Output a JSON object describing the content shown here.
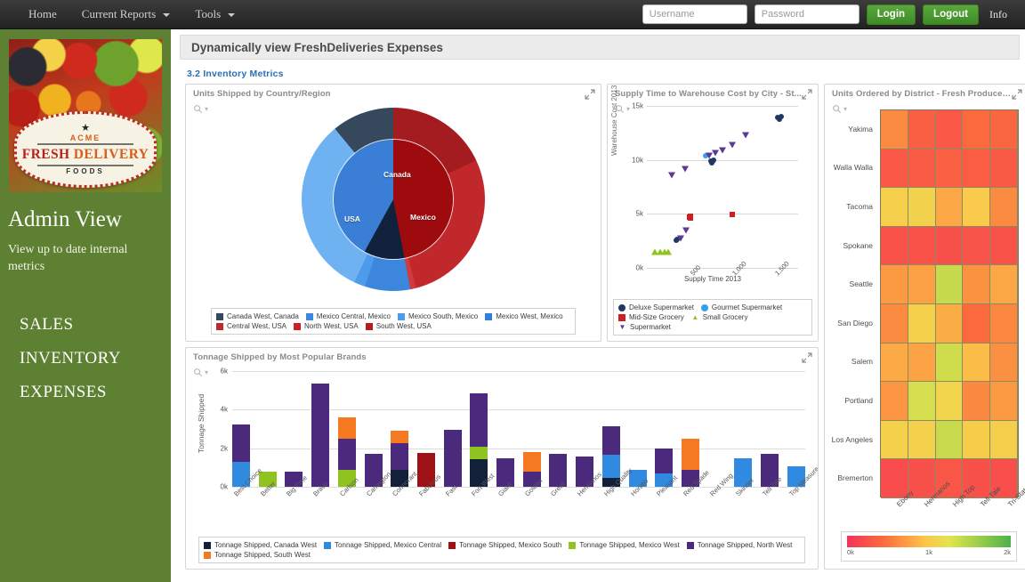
{
  "navbar": {
    "items": [
      {
        "label": "Home",
        "caret": false
      },
      {
        "label": "Current Reports",
        "caret": true
      },
      {
        "label": "Tools",
        "caret": true
      }
    ],
    "username_placeholder": "Username",
    "password_placeholder": "Password",
    "username_value": "",
    "password_value": "",
    "login_label": "Login",
    "logout_label": "Logout",
    "info_label": "Info",
    "accent_green": "#4a962d"
  },
  "sidebar": {
    "logo": {
      "star": "★",
      "acme": "ACME",
      "word1": "FRESH",
      "word2": "DELIVERY",
      "foods": "FOODS"
    },
    "title": "Admin View",
    "subtitle": "View up to date internal metrics",
    "links": [
      {
        "label": "SALES"
      },
      {
        "label": "INVENTORY"
      },
      {
        "label": "EXPENSES"
      }
    ],
    "bg_color": "#5d8032"
  },
  "header": {
    "title": "Dynamically view FreshDeliveries Expenses"
  },
  "section": {
    "title": "3.2 Inventory Metrics",
    "color": "#2a6fb5"
  },
  "panels": {
    "donut": {
      "title": "Units Shipped by Country/Region",
      "expand_icon": "expand-icon"
    },
    "scatter": {
      "title": "Supply Time to Warehouse Cost by City - St...",
      "expand_icon": "expand-icon"
    },
    "heatmap": {
      "title": "Units Ordered by District - Fresh Produce Br...",
      "expand_icon": "expand-icon"
    },
    "bar": {
      "title": "Tonnage Shipped by Most Popular Brands",
      "expand_icon": "expand-icon"
    }
  },
  "chart_data": [
    {
      "id": "donut",
      "type": "pie",
      "title": "Units Shipped by Country/Region",
      "inner_ring": [
        {
          "label": "USA",
          "value": 47,
          "color": "#9e0b0f"
        },
        {
          "label": "Canada",
          "value": 11,
          "color": "#10213c"
        },
        {
          "label": "Mexico",
          "value": 42,
          "color": "#3a7fd5"
        }
      ],
      "outer_ring": [
        {
          "label": "North West, USA",
          "value": 18,
          "color": "#a51c20"
        },
        {
          "label": "Central West, USA",
          "value": 28,
          "color": "#c0282c"
        },
        {
          "label": "South West, USA",
          "value": 1,
          "color": "#d13a3e"
        },
        {
          "label": "Mexico West, Mexico",
          "value": 8,
          "color": "#3d86dd"
        },
        {
          "label": "Mexico South, Mexico",
          "value": 2,
          "color": "#4e9bec"
        },
        {
          "label": "Mexico Central, Mexico",
          "value": 32,
          "color": "#6fb2f2"
        },
        {
          "label": "Canada West, Canada",
          "value": 11,
          "color": "#36485c"
        }
      ],
      "legend": [
        {
          "label": "Canada West, Canada",
          "color": "#36485c"
        },
        {
          "label": "Mexico Central, Mexico",
          "color": "#3d86dd"
        },
        {
          "label": "Mexico South, Mexico",
          "color": "#4e9bec"
        },
        {
          "label": "Mexico West, Mexico",
          "color": "#2f7fe0"
        },
        {
          "label": "Central West, USA",
          "color": "#c0282c"
        },
        {
          "label": "North West, USA",
          "color": "#cc1f22"
        },
        {
          "label": "South West, USA",
          "color": "#b91c1f"
        }
      ]
    },
    {
      "id": "scatter",
      "type": "scatter",
      "title": "Supply Time to Warehouse Cost by City - St...",
      "xlabel": "Supply Time 2013",
      "ylabel": "Warehouse Cost 2013",
      "xticks": [
        "500",
        "1,000",
        "1,500"
      ],
      "yticks": [
        "0k",
        "5k",
        "10k",
        "15k"
      ],
      "xlim": [
        0,
        1800
      ],
      "ylim": [
        0,
        15000
      ],
      "series": [
        {
          "name": "Deluxe Supermarket",
          "color": "#1f3864",
          "marker": "circle",
          "points": [
            [
              1560,
              13900
            ],
            [
              1600,
              14000
            ],
            [
              1580,
              13800
            ],
            [
              360,
              2600
            ],
            [
              350,
              2550
            ],
            [
              760,
              9850
            ],
            [
              780,
              9900
            ],
            [
              770,
              9750
            ],
            [
              790,
              10000
            ]
          ]
        },
        {
          "name": "Gourmet Supermarket",
          "color": "#3a9ee8",
          "marker": "circle",
          "points": [
            [
              700,
              10350
            ]
          ]
        },
        {
          "name": "Mid-Size Grocery",
          "color": "#cc1f22",
          "marker": "square",
          "points": [
            [
              505,
              4700
            ],
            [
              515,
              4650
            ],
            [
              520,
              4750
            ],
            [
              1020,
              4950
            ]
          ]
        },
        {
          "name": "Small Grocery",
          "color": "#8fc31f",
          "marker": "triangle",
          "points": [
            [
              100,
              1500
            ],
            [
              160,
              1480
            ],
            [
              210,
              1470
            ],
            [
              250,
              1490
            ]
          ]
        },
        {
          "name": "Supermarket",
          "color": "#5b3a91",
          "marker": "triangle-down",
          "points": [
            [
              300,
              8600
            ],
            [
              450,
              9150
            ],
            [
              740,
              10400
            ],
            [
              810,
              10600
            ],
            [
              900,
              10900
            ],
            [
              1020,
              11400
            ],
            [
              1180,
              12300
            ],
            [
              400,
              2750
            ],
            [
              470,
              3500
            ]
          ]
        }
      ],
      "legend": [
        {
          "label": "Deluxe Supermarket",
          "color": "#1f3864",
          "marker": "circle"
        },
        {
          "label": "Gourmet Supermarket",
          "color": "#3a9ee8",
          "marker": "circle"
        },
        {
          "label": "Mid-Size Grocery",
          "color": "#cc1f22",
          "marker": "square"
        },
        {
          "label": "Small Grocery",
          "color": "#8fc31f",
          "marker": "triangle"
        },
        {
          "label": "Supermarket",
          "color": "#5b3a91",
          "marker": "triangle-down"
        }
      ]
    },
    {
      "id": "heatmap",
      "type": "heatmap",
      "title": "Units Ordered by District - Fresh Produce Br...",
      "columns": [
        "Ebony",
        "Hermanos",
        "High Top",
        "Tell Tale",
        "Tri-State"
      ],
      "rows": [
        "Yakima",
        "Walla Walla",
        "Tacoma",
        "Spokane",
        "Seattle",
        "San Diego",
        "Salem",
        "Portland",
        "Los Angeles",
        "Bremerton"
      ],
      "values": [
        [
          620,
          340,
          300,
          430,
          400
        ],
        [
          300,
          320,
          360,
          330,
          310
        ],
        [
          1050,
          1080,
          780,
          1000,
          620
        ],
        [
          250,
          250,
          230,
          260,
          250
        ],
        [
          700,
          740,
          1400,
          660,
          780
        ],
        [
          620,
          1060,
          820,
          430,
          600
        ],
        [
          800,
          760,
          1350,
          900,
          650
        ],
        [
          680,
          1320,
          1100,
          610,
          700
        ],
        [
          1060,
          1070,
          1380,
          1020,
          1040
        ],
        [
          200,
          230,
          280,
          240,
          220
        ]
      ],
      "scale": {
        "ticks": [
          "0k",
          "1k",
          "2k"
        ],
        "min": 0,
        "max": 2000,
        "gradient": [
          "#f5325b",
          "#fb6b3c",
          "#fcc64a",
          "#e5e34e",
          "#9dcf4a",
          "#4eb14b"
        ]
      }
    },
    {
      "id": "bar",
      "type": "bar",
      "title": "Tonnage Shipped by Most Popular Brands",
      "ylabel": "Tonnage Shipped",
      "yticks": [
        "0k",
        "2k",
        "4k",
        "6k"
      ],
      "ylim": [
        0,
        6000
      ],
      "categories": [
        "Best Choice",
        "Better",
        "Big Time",
        "Bravo",
        "Carlson",
        "Carrington",
        "Cormorant",
        "Fabulous",
        "Fast",
        "Fort West",
        "Giant",
        "Golden",
        "Great",
        "Hermanos",
        "High Quality",
        "Horatio",
        "Pleasant",
        "Red Spade",
        "Red Wing",
        "Skinner",
        "Tell Tale",
        "Top Measure"
      ],
      "series": [
        {
          "name": "Tonnage Shipped, Canada West",
          "color": "#12203a",
          "values": [
            0,
            0,
            0,
            0,
            0,
            0,
            900,
            0,
            0,
            1450,
            0,
            0,
            0,
            0,
            450,
            0,
            0,
            0,
            0,
            0,
            0,
            0
          ]
        },
        {
          "name": "Tonnage Shipped, Mexico Central",
          "color": "#2f8ae0",
          "values": [
            1300,
            0,
            0,
            0,
            0,
            0,
            0,
            0,
            0,
            0,
            0,
            0,
            0,
            0,
            1200,
            900,
            680,
            0,
            0,
            1500,
            0,
            1050
          ]
        },
        {
          "name": "Tonnage Shipped, Mexico South",
          "color": "#9e1114",
          "values": [
            0,
            0,
            0,
            0,
            0,
            0,
            0,
            1750,
            0,
            0,
            0,
            0,
            0,
            0,
            0,
            0,
            0,
            0,
            0,
            0,
            0,
            0
          ]
        },
        {
          "name": "Tonnage Shipped, Mexico West",
          "color": "#8fc31f",
          "values": [
            0,
            780,
            0,
            0,
            900,
            0,
            0,
            0,
            0,
            650,
            0,
            0,
            0,
            0,
            0,
            0,
            0,
            0,
            0,
            0,
            0,
            0
          ]
        },
        {
          "name": "Tonnage Shipped, North West",
          "color": "#4b2a7e",
          "values": [
            1950,
            0,
            800,
            5350,
            1600,
            1700,
            1350,
            0,
            2950,
            2750,
            1500,
            800,
            1700,
            1550,
            1500,
            0,
            1300,
            900,
            0,
            0,
            1700,
            0
          ]
        },
        {
          "name": "Tonnage Shipped, South West",
          "color": "#f47920",
          "values": [
            0,
            0,
            0,
            0,
            1100,
            0,
            650,
            0,
            0,
            0,
            0,
            1000,
            0,
            0,
            0,
            0,
            0,
            1600,
            0,
            0,
            0,
            0
          ]
        }
      ],
      "legend": [
        {
          "label": "Tonnage Shipped, Canada West",
          "color": "#12203a"
        },
        {
          "label": "Tonnage Shipped, Mexico Central",
          "color": "#2f8ae0"
        },
        {
          "label": "Tonnage Shipped, Mexico South",
          "color": "#9e1114"
        },
        {
          "label": "Tonnage Shipped, Mexico West",
          "color": "#8fc31f"
        },
        {
          "label": "Tonnage Shipped, North West",
          "color": "#4b2a7e"
        },
        {
          "label": "Tonnage Shipped, South West",
          "color": "#f47920"
        }
      ]
    }
  ]
}
